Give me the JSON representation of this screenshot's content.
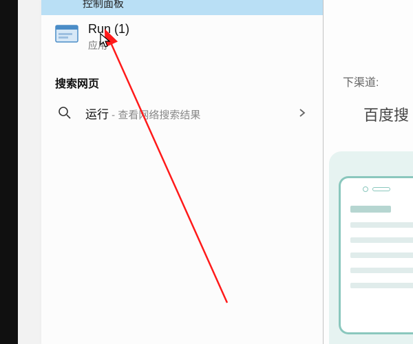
{
  "search_panel": {
    "highlighted_item_label": "控制面板",
    "app_result": {
      "title": "Run (1)",
      "subtitle": "应用"
    },
    "web_section_header": "搜索网页",
    "web_result": {
      "query": "运行",
      "suffix": " - 查看网络搜索结果"
    }
  },
  "right_side": {
    "channel_text": "下渠道:",
    "service_label": "百度搜"
  }
}
